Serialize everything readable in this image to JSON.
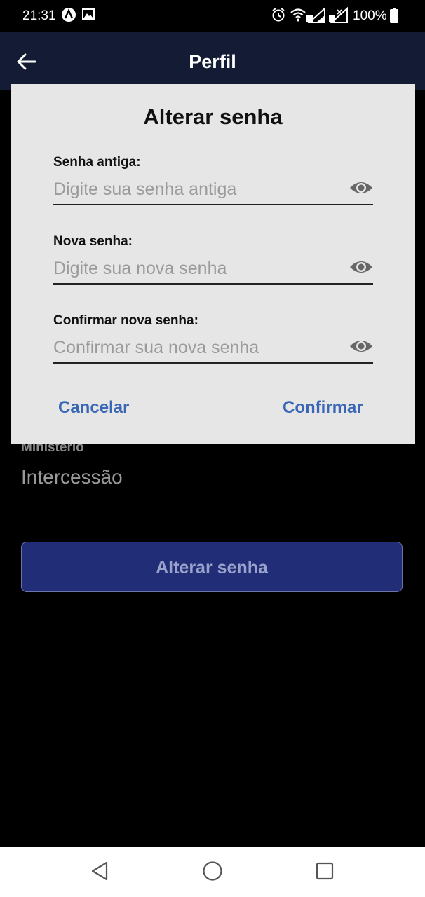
{
  "status_bar": {
    "time": "21:31",
    "battery": "100%",
    "icons": [
      "app-notification-icon",
      "image-icon",
      "alarm-icon",
      "wifi-icon",
      "signal-icon",
      "signal-icon",
      "battery-icon"
    ]
  },
  "app_bar": {
    "title": "Perfil",
    "background": "#141b34"
  },
  "profile": {
    "field_label": "Ministério",
    "field_value": "Intercessão",
    "change_password_button": "Alterar senha",
    "button_color": "#212d76"
  },
  "dialog": {
    "title": "Alterar senha",
    "fields": [
      {
        "label": "Senha antiga:",
        "placeholder": "Digite sua senha antiga"
      },
      {
        "label": "Nova senha:",
        "placeholder": "Digite sua nova senha"
      },
      {
        "label": "Confirmar nova senha:",
        "placeholder": "Confirmar sua nova senha"
      }
    ],
    "cancel_label": "Cancelar",
    "confirm_label": "Confirmar",
    "accent": "#3a67b5",
    "background": "#e6e6e6"
  },
  "nav_bar": {
    "icons": [
      "back-triangle-icon",
      "home-circle-icon",
      "recents-square-icon"
    ]
  }
}
